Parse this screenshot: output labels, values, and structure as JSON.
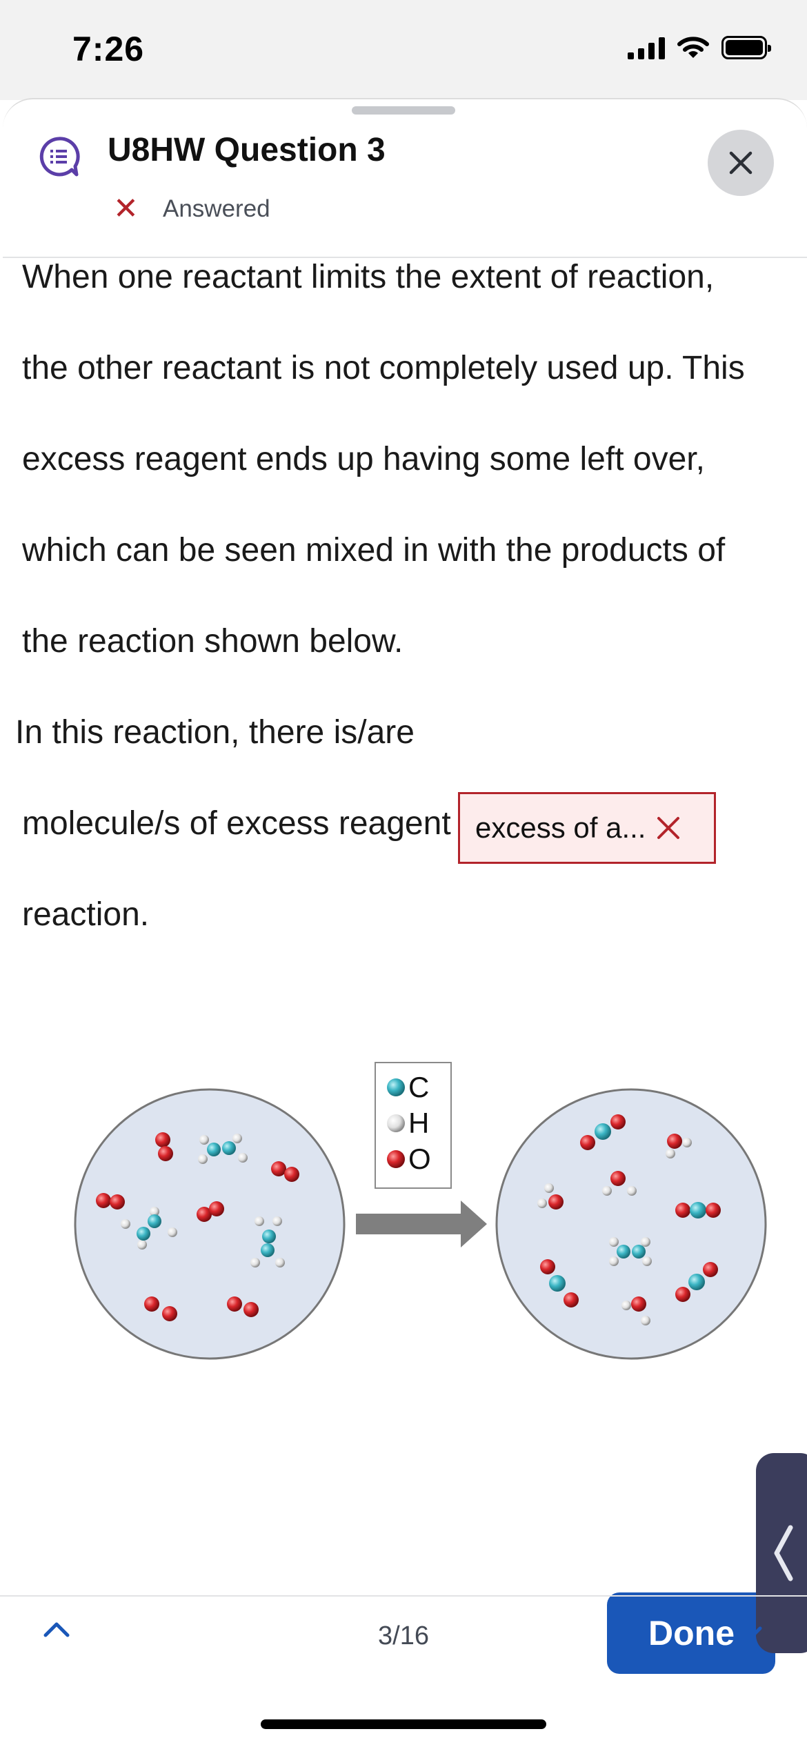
{
  "status_bar": {
    "time": "7:26"
  },
  "header": {
    "title": "U8HW Question 3",
    "status": "Answered",
    "status_color": "#b3242b"
  },
  "question": {
    "lines": [
      "When one reactant limits the extent of reaction,",
      "the other reactant is not completely used up. This",
      "excess reagent ends up having some left over,",
      "which can be seen mixed in with the products of",
      "the reaction shown below."
    ],
    "blank_prefix": "In this reaction, there is/are",
    "answer_text": "excess of a...",
    "after_lines": [
      "molecule/s of excess reagent left over after the",
      "reaction."
    ]
  },
  "figure": {
    "legend": [
      {
        "symbol": "C",
        "color": "#3bb5c4"
      },
      {
        "symbol": "H",
        "color": "#e6e6e6"
      },
      {
        "symbol": "O",
        "color": "#d9262b"
      }
    ]
  },
  "footer": {
    "done_label": "Done",
    "page_indicator": "3/16"
  },
  "colors": {
    "accent": "#1a57b8",
    "error": "#b3242b",
    "icon_purple": "#5b3ea8"
  }
}
